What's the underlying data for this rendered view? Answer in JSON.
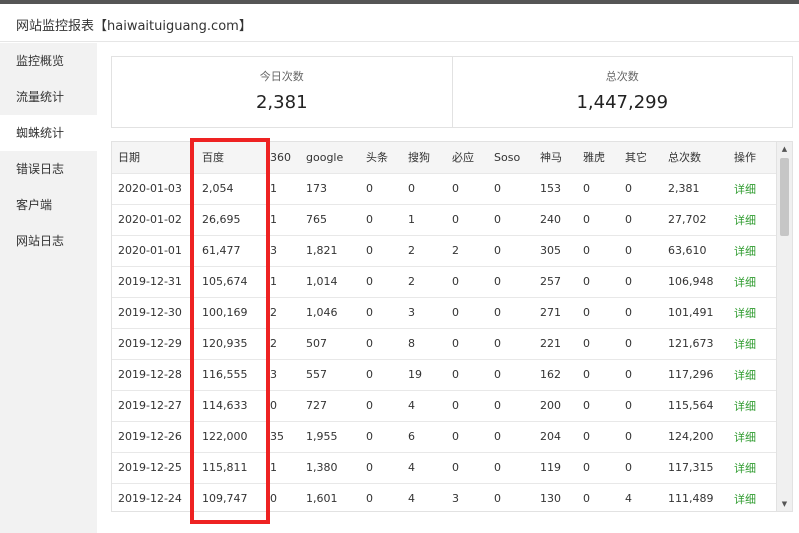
{
  "window": {
    "title": "网站监控报表【haiwaituiguang.com】"
  },
  "sidebar": {
    "items": [
      {
        "label": "监控概览",
        "active": false
      },
      {
        "label": "流量统计",
        "active": false
      },
      {
        "label": "蜘蛛统计",
        "active": true
      },
      {
        "label": "错误日志",
        "active": false
      },
      {
        "label": "客户端",
        "active": false
      },
      {
        "label": "网站日志",
        "active": false
      }
    ]
  },
  "stats": {
    "today_label": "今日次数",
    "today_value": "2,381",
    "total_label": "总次数",
    "total_value": "1,447,299"
  },
  "table": {
    "headers": [
      "日期",
      "百度",
      "360",
      "google",
      "头条",
      "搜狗",
      "必应",
      "Soso",
      "神马",
      "雅虎",
      "其它",
      "总次数",
      "操作"
    ],
    "rows": [
      [
        "2020-01-03",
        "2,054",
        "1",
        "173",
        "0",
        "0",
        "0",
        "0",
        "153",
        "0",
        "0",
        "2,381",
        "详细"
      ],
      [
        "2020-01-02",
        "26,695",
        "1",
        "765",
        "0",
        "1",
        "0",
        "0",
        "240",
        "0",
        "0",
        "27,702",
        "详细"
      ],
      [
        "2020-01-01",
        "61,477",
        "3",
        "1,821",
        "0",
        "2",
        "2",
        "0",
        "305",
        "0",
        "0",
        "63,610",
        "详细"
      ],
      [
        "2019-12-31",
        "105,674",
        "1",
        "1,014",
        "0",
        "2",
        "0",
        "0",
        "257",
        "0",
        "0",
        "106,948",
        "详细"
      ],
      [
        "2019-12-30",
        "100,169",
        "2",
        "1,046",
        "0",
        "3",
        "0",
        "0",
        "271",
        "0",
        "0",
        "101,491",
        "详细"
      ],
      [
        "2019-12-29",
        "120,935",
        "2",
        "507",
        "0",
        "8",
        "0",
        "0",
        "221",
        "0",
        "0",
        "121,673",
        "详细"
      ],
      [
        "2019-12-28",
        "116,555",
        "3",
        "557",
        "0",
        "19",
        "0",
        "0",
        "162",
        "0",
        "0",
        "117,296",
        "详细"
      ],
      [
        "2019-12-27",
        "114,633",
        "0",
        "727",
        "0",
        "4",
        "0",
        "0",
        "200",
        "0",
        "0",
        "115,564",
        "详细"
      ],
      [
        "2019-12-26",
        "122,000",
        "35",
        "1,955",
        "0",
        "6",
        "0",
        "0",
        "204",
        "0",
        "0",
        "124,200",
        "详细"
      ],
      [
        "2019-12-25",
        "115,811",
        "1",
        "1,380",
        "0",
        "4",
        "0",
        "0",
        "119",
        "0",
        "0",
        "117,315",
        "详细"
      ],
      [
        "2019-12-24",
        "109,747",
        "0",
        "1,601",
        "0",
        "4",
        "3",
        "0",
        "130",
        "0",
        "4",
        "111,489",
        "详细"
      ]
    ]
  },
  "colors": {
    "highlight": "#ee2222",
    "action_link": "#2e9b2e"
  },
  "icons": {
    "scroll_up": "triangle-up",
    "scroll_down": "triangle-down"
  }
}
